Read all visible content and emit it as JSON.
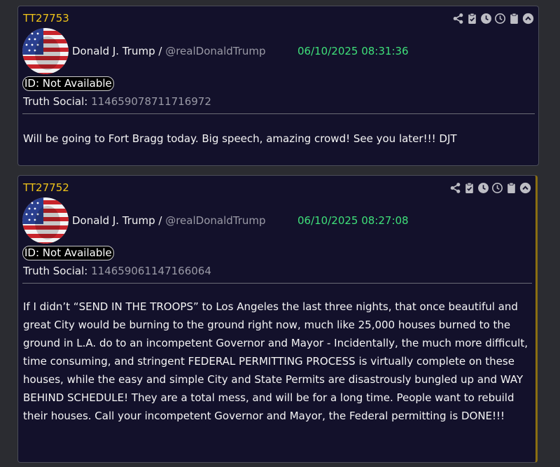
{
  "icons": [
    "share-icon",
    "clipboard-check-icon",
    "clock-filled-icon",
    "clock-outline-icon",
    "clipboard-icon",
    "collapse-up-icon"
  ],
  "colors": {
    "post_id": "#f0c419",
    "timestamp": "#3fe07a",
    "handle": "#9a9aa6",
    "card_bg": "#13112b",
    "page_bg": "#2b2c31"
  },
  "posts": [
    {
      "id": "TT27753",
      "author_name": "Donald J. Trump /",
      "handle": "@realDonaldTrump",
      "timestamp": "06/10/2025 08:31:36",
      "id_label": "ID: Not Available",
      "platform_label": "Truth Social:",
      "platform_post_id": "114659078711716972",
      "text": "Will be going to Fort Bragg today. Big speech, amazing crowd! See you later!!! DJT"
    },
    {
      "id": "TT27752",
      "author_name": "Donald J. Trump /",
      "handle": "@realDonaldTrump",
      "timestamp": "06/10/2025 08:27:08",
      "id_label": "ID: Not Available",
      "platform_label": "Truth Social:",
      "platform_post_id": "114659061147166064",
      "text": "If I didn’t “SEND IN THE TROOPS” to Los Angeles the last three nights, that once beautiful and great City would be burning to the ground right now, much like 25,000 houses burned to the ground in L.A. do to an incompetent Governor and Mayor - Incidentally, the much more difficult, time consuming, and stringent FEDERAL PERMITTING PROCESS  is virtually complete on these houses, while the easy and simple City and State Permits are disastrously bungled up and WAY BEHIND SCHEDULE! They are a total mess, and will be for a long time. People want to rebuild their houses. Call your incompetent Governor and Mayor, the Federal permitting is DONE!!!"
    }
  ]
}
